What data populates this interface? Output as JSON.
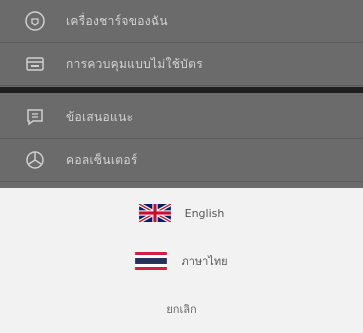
{
  "menu": {
    "items": [
      {
        "label": "เครื่องชาร์จของฉัน",
        "icon": "charger-icon"
      },
      {
        "label": "การควบคุมแบบไม่ใช้บัตร",
        "icon": "card-icon"
      },
      {
        "label": "ข้อเสนอแนะ",
        "icon": "feedback-icon"
      },
      {
        "label": "คอลเซ็นเตอร์",
        "icon": "call-center-icon"
      }
    ]
  },
  "language_sheet": {
    "options": [
      {
        "label": "English",
        "icon": "uk-flag-icon"
      },
      {
        "label": "ภาษาไทย",
        "icon": "thai-flag-icon"
      }
    ],
    "cancel_label": "ยกเลิก"
  },
  "colors": {
    "overlay_bg": "#6b6b6b",
    "sheet_bg": "#f2f2f2",
    "menu_text": "#d3d3d3"
  }
}
